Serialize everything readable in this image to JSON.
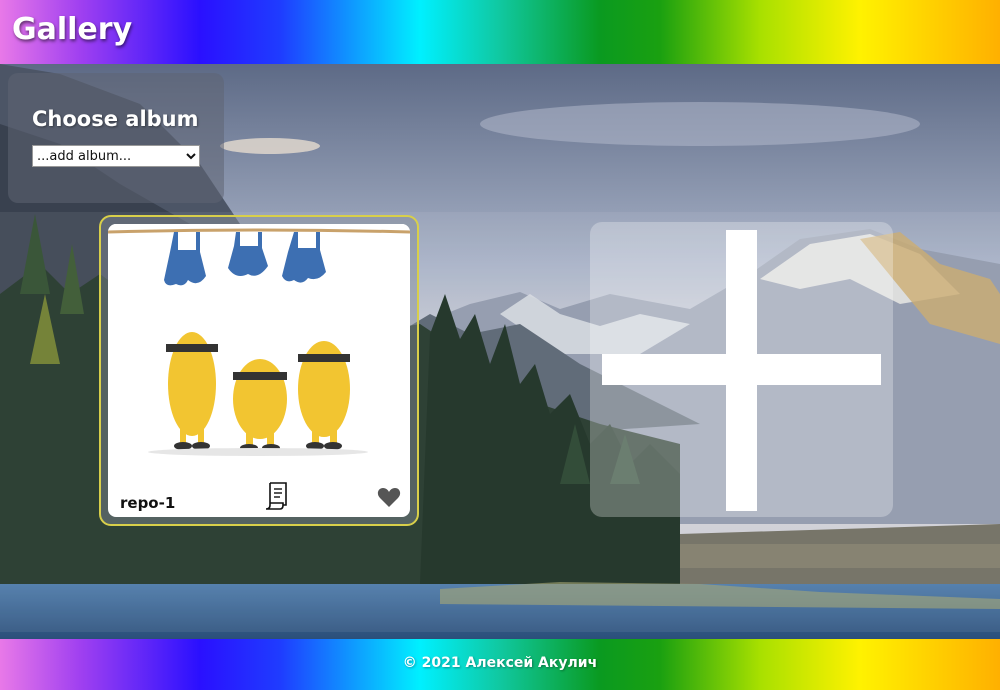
{
  "header": {
    "title": "Gallery"
  },
  "album_picker": {
    "title": "Choose album",
    "selected_option": "...add album..."
  },
  "albums": [
    {
      "name": "repo-1",
      "icons": [
        "document-icon",
        "heart-icon"
      ]
    }
  ],
  "add_tile": {
    "icon": "plus-icon"
  },
  "footer": {
    "text": "© 2021 Алексей Акулич"
  },
  "colors": {
    "card_border": "#d8cf4a",
    "heart": "#555555",
    "rainbow": [
      "#e879e8",
      "#2a10ff",
      "#00f0ff",
      "#0a9a20",
      "#fff200",
      "#ffb000"
    ]
  }
}
